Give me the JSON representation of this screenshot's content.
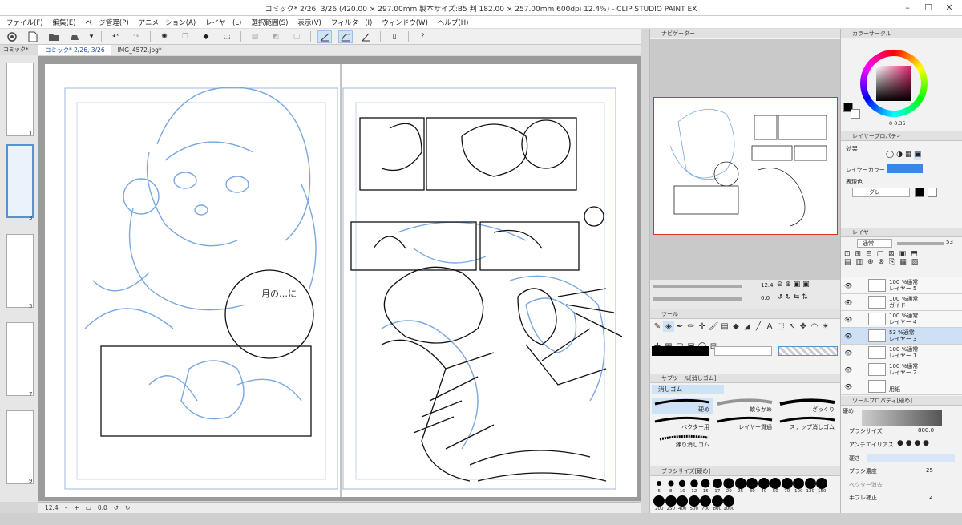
{
  "app": {
    "title": "コミック* 2/26, 3/26 (420.00 × 297.00mm 製本サイズ:B5 判 182.00 × 257.00mm 600dpi 12.4%) - CLIP STUDIO PAINT EX"
  },
  "menu": [
    "ファイル(F)",
    "編集(E)",
    "ページ管理(P)",
    "アニメーション(A)",
    "レイヤー(L)",
    "選択範囲(S)",
    "表示(V)",
    "フィルター(I)",
    "ウィンドウ(W)",
    "ヘルプ(H)"
  ],
  "tabs": {
    "strip": "コミック*",
    "doc1": "コミック* 2/26, 3/26",
    "doc2": "IMG_4572.jpg*"
  },
  "pages": {
    "p1": "1",
    "p2": "3",
    "p3": "5",
    "p4": "7",
    "p5": "9"
  },
  "status": {
    "zoom": "12.4",
    "angle": "0.0"
  },
  "navigator": {
    "title": "ナビゲーター",
    "zoom": "12.4",
    "angle": "0.0"
  },
  "colorcircle": {
    "title": "カラーサークル",
    "hsv": "0 0.35"
  },
  "layerprop": {
    "title": "レイヤープロパティ",
    "effect": "効果",
    "layercolor": "レイヤーカラー",
    "express": "表現色",
    "gray": "グレー"
  },
  "layerpanel": {
    "title": "レイヤー",
    "blend": "通常",
    "opacity": "53"
  },
  "layers": [
    {
      "l1": "100 %通常",
      "l2": "レイヤー 5"
    },
    {
      "l1": "100 %通常",
      "l2": "ガイド"
    },
    {
      "l1": "100 %通常",
      "l2": "レイヤー 4"
    },
    {
      "l1": "53 %通常",
      "l2": "レイヤー 3"
    },
    {
      "l1": "100 %通常",
      "l2": "レイヤー 1"
    },
    {
      "l1": "100 %通常",
      "l2": "レイヤー 2"
    },
    {
      "l1": "",
      "l2": "用紙"
    }
  ],
  "toolpanel": {
    "title": "ツール"
  },
  "subtool": {
    "title": "サブツール[消しゴム]",
    "group": "消しゴム",
    "b1": "硬め",
    "b2": "軟らかめ",
    "b3": "ざっくり",
    "b4": "ベクター用",
    "b5": "レイヤー貫通",
    "b6": "スナップ消しゴム",
    "b7": "練り消しゴム"
  },
  "brushsize": {
    "title": "ブラシサイズ[硬め]",
    "sizes": [
      "5",
      "8",
      "10",
      "12",
      "15",
      "17",
      "20",
      "25",
      "30",
      "40",
      "50",
      "70",
      "100",
      "120",
      "150",
      "200",
      "250",
      "400",
      "500",
      "700",
      "800",
      "1000"
    ]
  },
  "toolprop": {
    "title": "ツールプロパティ[硬め]",
    "name": "硬め",
    "size_label": "ブラシサイズ",
    "size_val": "800.0",
    "aa_label": "アンチエイリアス",
    "hard_label": "硬さ",
    "density_label": "ブラシ濃度",
    "density_val": "25",
    "vector_label": "ベクター消去",
    "stab_label": "手ブレ補正",
    "stab_val": "2"
  },
  "colors": {
    "accent": "#5a8fd0",
    "sketch_blue": "#7aa8e0",
    "red_frame": "#e03030"
  }
}
